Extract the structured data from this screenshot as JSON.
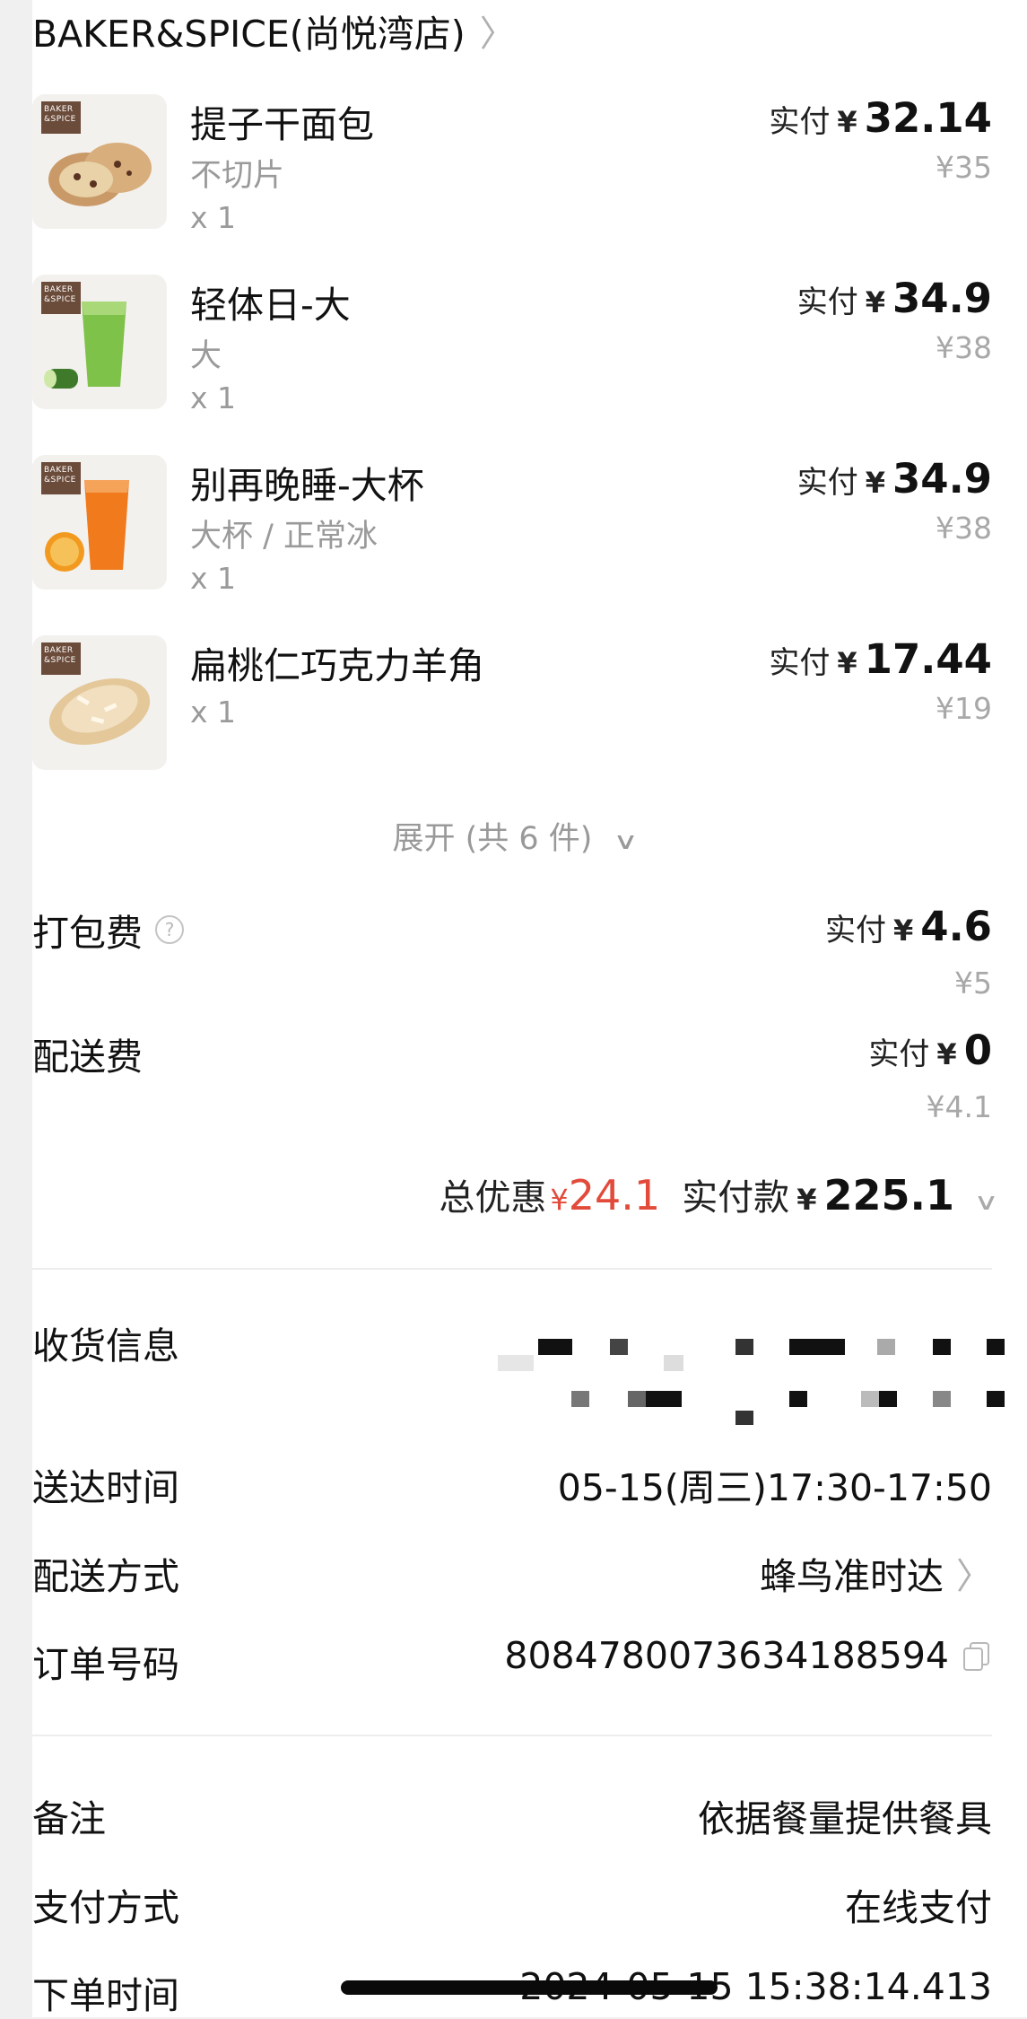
{
  "store": {
    "name": "BAKER&SPICE(尚悦湾店)"
  },
  "items": [
    {
      "name": "提子干面包",
      "spec": "不切片",
      "qty": "x 1",
      "paid_label": "实付",
      "currency": "¥",
      "paid": "32.14",
      "original": "¥35",
      "logo": "BAKER &SPICE"
    },
    {
      "name": "轻体日-大",
      "spec": "大",
      "qty": "x 1",
      "paid_label": "实付",
      "currency": "¥",
      "paid": "34.9",
      "original": "¥38",
      "logo": "BAKER &SPICE"
    },
    {
      "name": "别再晚睡-大杯",
      "spec": "大杯 / 正常冰",
      "qty": "x 1",
      "paid_label": "实付",
      "currency": "¥",
      "paid": "34.9",
      "original": "¥38",
      "logo": "BAKER &SPICE"
    },
    {
      "name": "扁桃仁巧克力羊角",
      "qty": "x 1",
      "paid_label": "实付",
      "currency": "¥",
      "paid": "17.44",
      "original": "¥19",
      "logo": "BAKER &SPICE"
    }
  ],
  "expand": {
    "label": "展开 (共 6 件)"
  },
  "fees": [
    {
      "name": "打包费",
      "paid_label": "实付",
      "currency": "¥",
      "paid": "4.6",
      "original": "¥5"
    },
    {
      "name": "配送费",
      "paid_label": "实付",
      "currency": "¥",
      "paid": "0",
      "original": "¥4.1"
    }
  ],
  "summary": {
    "discount_label": "总优惠",
    "discount_currency": "¥",
    "discount": "24.1",
    "paid_label": "实付款",
    "paid_currency": "¥",
    "paid": "225.1"
  },
  "info": {
    "address_label": "收货信息",
    "delivery_time_label": "送达时间",
    "delivery_time": "05-15(周三)17:30-17:50",
    "delivery_method_label": "配送方式",
    "delivery_method": "蜂鸟准时达",
    "order_no_label": "订单号码",
    "order_no": "8084780073634188594",
    "remark_label": "备注",
    "remark": "依据餐量提供餐具",
    "payment_label": "支付方式",
    "payment": "在线支付",
    "order_time_label": "下单时间",
    "order_time": "2024-05-15 15:38:14.413"
  },
  "colors": {
    "accent_red": "#e24a3a",
    "muted": "#9a9a9a"
  }
}
